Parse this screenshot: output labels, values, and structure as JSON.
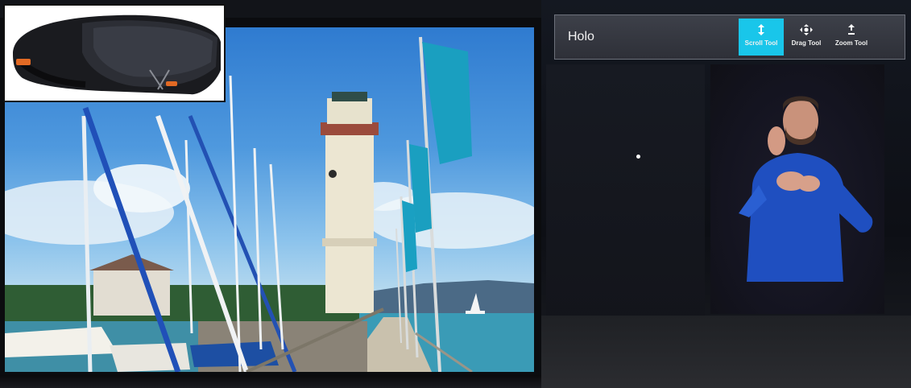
{
  "toolbar": {
    "title": "Holo",
    "tools": [
      {
        "label": "Scroll Tool",
        "icon": "scroll-arrows-icon",
        "active": true
      },
      {
        "label": "Drag Tool",
        "icon": "drag-move-icon",
        "active": false
      },
      {
        "label": "Zoom Tool",
        "icon": "zoom-arrows-icon",
        "active": false
      }
    ]
  },
  "colors": {
    "active_tool": "#19c6ea",
    "toolbar_bg": "#33363e",
    "sky": "#4f99de",
    "hologram_shirt": "#1f4fc0"
  }
}
